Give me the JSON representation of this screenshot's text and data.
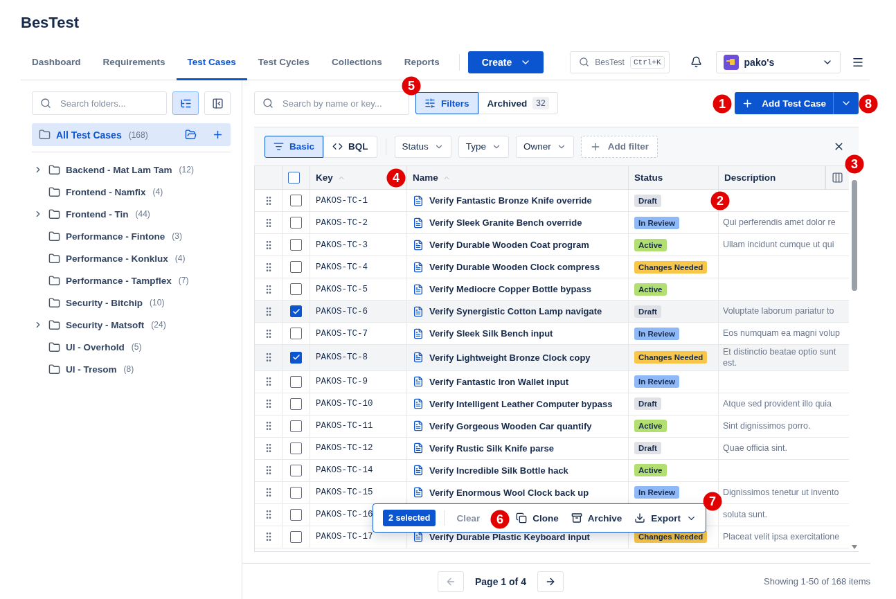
{
  "app_title": "BesTest",
  "nav_tabs": [
    {
      "label": "Dashboard",
      "selected": false
    },
    {
      "label": "Requirements",
      "selected": false
    },
    {
      "label": "Test Cases",
      "selected": true
    },
    {
      "label": "Test Cycles",
      "selected": false
    },
    {
      "label": "Collections",
      "selected": false
    },
    {
      "label": "Reports",
      "selected": false
    }
  ],
  "create_button": "Create",
  "global_search": {
    "placeholder": "BesTest",
    "shortcut": "Ctrl+K"
  },
  "workspace": "pako's",
  "sidebar": {
    "search_placeholder": "Search folders...",
    "tree_view_on": true,
    "all_item": {
      "label": "All Test Cases",
      "count": "(168)",
      "selected": true
    },
    "folders": [
      {
        "name": "Backend - Mat Lam Tam",
        "count": "(12)",
        "expandable": true
      },
      {
        "name": "Frontend - Namfix",
        "count": "(4)",
        "expandable": false
      },
      {
        "name": "Frontend - Tin",
        "count": "(44)",
        "expandable": true
      },
      {
        "name": "Performance - Fintone",
        "count": "(3)",
        "expandable": false
      },
      {
        "name": "Performance - Konklux",
        "count": "(4)",
        "expandable": false
      },
      {
        "name": "Performance - Tampflex",
        "count": "(7)",
        "expandable": false
      },
      {
        "name": "Security - Bitchip",
        "count": "(10)",
        "expandable": false
      },
      {
        "name": "Security - Matsoft",
        "count": "(24)",
        "expandable": true
      },
      {
        "name": "UI - Overhold",
        "count": "(5)",
        "expandable": false
      },
      {
        "name": "UI - Tresom",
        "count": "(8)",
        "expandable": false
      }
    ]
  },
  "toolbar": {
    "search_placeholder": "Search by name or key...",
    "filters": {
      "label": "Filters",
      "selected": true
    },
    "archived": {
      "label": "Archived",
      "count": "32",
      "selected": false
    },
    "add_button": "Add Test Case"
  },
  "filter_bar": {
    "modes": [
      {
        "label": "Basic",
        "selected": true
      },
      {
        "label": "BQL",
        "selected": false
      }
    ],
    "dropdowns": [
      "Status",
      "Type",
      "Owner"
    ],
    "add_filter": "Add filter"
  },
  "table": {
    "columns": [
      "Key",
      "Name",
      "Status",
      "Description"
    ],
    "header_checked": false,
    "rows": [
      {
        "key": "PAKOS-TC-1",
        "name": "Verify Fantastic Bronze Knife override",
        "status": {
          "label": "Draft",
          "color": "#dfe1e6"
        },
        "checked": false
      },
      {
        "key": "PAKOS-TC-2",
        "name": "Verify Sleek Granite Bench override",
        "status": {
          "label": "In Review",
          "color": "#8fb8f6"
        },
        "description": "Qui perferendis amet dolor re",
        "checked": false
      },
      {
        "key": "PAKOS-TC-3",
        "name": "Verify Durable Wooden Coat program",
        "status": {
          "label": "Active",
          "color": "#b3df72"
        },
        "description": "Ullam incidunt cumque ut qui",
        "checked": false
      },
      {
        "key": "PAKOS-TC-4",
        "name": "Verify Durable Wooden Clock compress",
        "status": {
          "label": "Changes Needed",
          "color": "#f8c649"
        },
        "checked": false
      },
      {
        "key": "PAKOS-TC-5",
        "name": "Verify Mediocre Copper Bottle bypass",
        "status": {
          "label": "Active",
          "color": "#b3df72"
        },
        "checked": false
      },
      {
        "key": "PAKOS-TC-6",
        "name": "Verify Synergistic Cotton Lamp navigate",
        "status": {
          "label": "Draft",
          "color": "#dfe1e6"
        },
        "description": "Voluptate laborum pariatur to",
        "checked": true
      },
      {
        "key": "PAKOS-TC-7",
        "name": "Verify Sleek Silk Bench input",
        "status": {
          "label": "In Review",
          "color": "#8fb8f6"
        },
        "description": "Eos numquam ea magni volup",
        "checked": false
      },
      {
        "key": "PAKOS-TC-8",
        "name": "Verify Lightweight Bronze Clock copy",
        "status": {
          "label": "Changes Needed",
          "color": "#f8c649"
        },
        "description": "Et distinctio beatae optio sunt est.",
        "checked": true
      },
      {
        "key": "PAKOS-TC-9",
        "name": "Verify Fantastic Iron Wallet input",
        "status": {
          "label": "In Review",
          "color": "#8fb8f6"
        },
        "checked": false
      },
      {
        "key": "PAKOS-TC-10",
        "name": "Verify Intelligent Leather Computer bypass",
        "status": {
          "label": "Draft",
          "color": "#dfe1e6"
        },
        "description": "Atque sed provident illo quia",
        "checked": false
      },
      {
        "key": "PAKOS-TC-11",
        "name": "Verify Gorgeous Wooden Car quantify",
        "status": {
          "label": "Active",
          "color": "#b3df72"
        },
        "description": "Sint dignissimos porro.",
        "checked": false
      },
      {
        "key": "PAKOS-TC-12",
        "name": "Verify Rustic Silk Knife parse",
        "status": {
          "label": "Draft",
          "color": "#dfe1e6"
        },
        "description": "Quae officia sint.",
        "checked": false
      },
      {
        "key": "PAKOS-TC-14",
        "name": "Verify Incredible Silk Bottle hack",
        "status": {
          "label": "Active",
          "color": "#b3df72"
        },
        "checked": false
      },
      {
        "key": "PAKOS-TC-15",
        "name": "Verify Enormous Wool Clock back up",
        "status": {
          "label": "In Review",
          "color": "#8fb8f6"
        },
        "description": "Dignissimos tenetur ut invento",
        "checked": false
      },
      {
        "key": "PAKOS-TC-16",
        "description": "soluta sunt.",
        "checked": false
      },
      {
        "key": "PAKOS-TC-17",
        "name": "Verify Durable Plastic Keyboard input",
        "status": {
          "label": "Changes Needed",
          "color": "#f8c649"
        },
        "description": "Placeat velit ipsa exercitatione",
        "checked": false
      }
    ]
  },
  "selection_bar": {
    "count": "2 selected",
    "clear": "Clear",
    "actions": [
      {
        "kind": "clone",
        "label": "Clone"
      },
      {
        "kind": "archive",
        "label": "Archive"
      },
      {
        "kind": "export",
        "label": "Export"
      }
    ]
  },
  "pagination": {
    "page": "Page 1 of 4",
    "summary": "Showing 1-50 of 168 items"
  },
  "annotations": [
    "1",
    "2",
    "3",
    "4",
    "5",
    "6",
    "7",
    "8"
  ]
}
